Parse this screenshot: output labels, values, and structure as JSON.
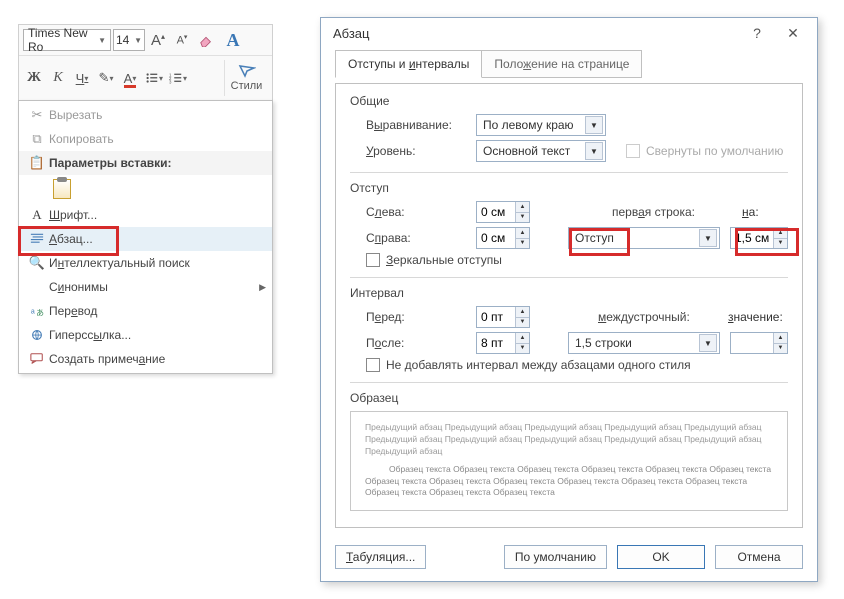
{
  "ribbon": {
    "font_name": "Times New Ro",
    "font_size": "14",
    "styles_label": "Стили",
    "btns": {
      "bigA": "A",
      "smallA": "A"
    }
  },
  "context": {
    "cut": "Вырезать",
    "copy": "Копировать",
    "paste_header": "Параметры вставки:",
    "font": "Шрифт...",
    "paragraph": "Абзац...",
    "smart_search": "Интеллектуальный поиск",
    "synonyms": "Синонимы",
    "translate": "Перевод",
    "hyperlink": "Гиперссылка...",
    "comment": "Создать примечание"
  },
  "dialog": {
    "title": "Абзац",
    "tab1": "Отступы и интервалы",
    "tab2": "Положение на странице",
    "group_general": "Общие",
    "align_label": "Выравнивание:",
    "align_value": "По левому краю",
    "level_label": "Уровень:",
    "level_value": "Основной текст",
    "collapsed": "Свернуты по умолчанию",
    "group_indent": "Отступ",
    "left_label": "Слева:",
    "left_value": "0 см",
    "right_label": "Справа:",
    "right_value": "0 см",
    "first_line_label": "первая строка:",
    "first_line_value": "Отступ",
    "by_label": "на:",
    "by_value": "1,5 см",
    "mirror": "Зеркальные отступы",
    "group_spacing": "Интервал",
    "before_label": "Перед:",
    "before_value": "0 пт",
    "after_label": "После:",
    "after_value": "8 пт",
    "line_label": "междустрочный:",
    "line_value": "1,5 строки",
    "at_label": "значение:",
    "at_value": "",
    "no_space": "Не добавлять интервал между абзацами одного стиля",
    "group_preview": "Образец",
    "preview_prev": "Предыдущий абзац Предыдущий абзац Предыдущий абзац Предыдущий абзац Предыдущий абзац Предыдущий абзац Предыдущий абзац Предыдущий абзац Предыдущий абзац Предыдущий абзац Предыдущий абзац",
    "preview_sample": "Образец текста Образец текста Образец текста Образец текста Образец текста Образец текста Образец текста Образец текста Образец текста Образец текста Образец текста Образец текста Образец текста Образец текста Образец текста",
    "tabs_btn": "Табуляция...",
    "default_btn": "По умолчанию",
    "ok_btn": "OK",
    "cancel_btn": "Отмена"
  }
}
